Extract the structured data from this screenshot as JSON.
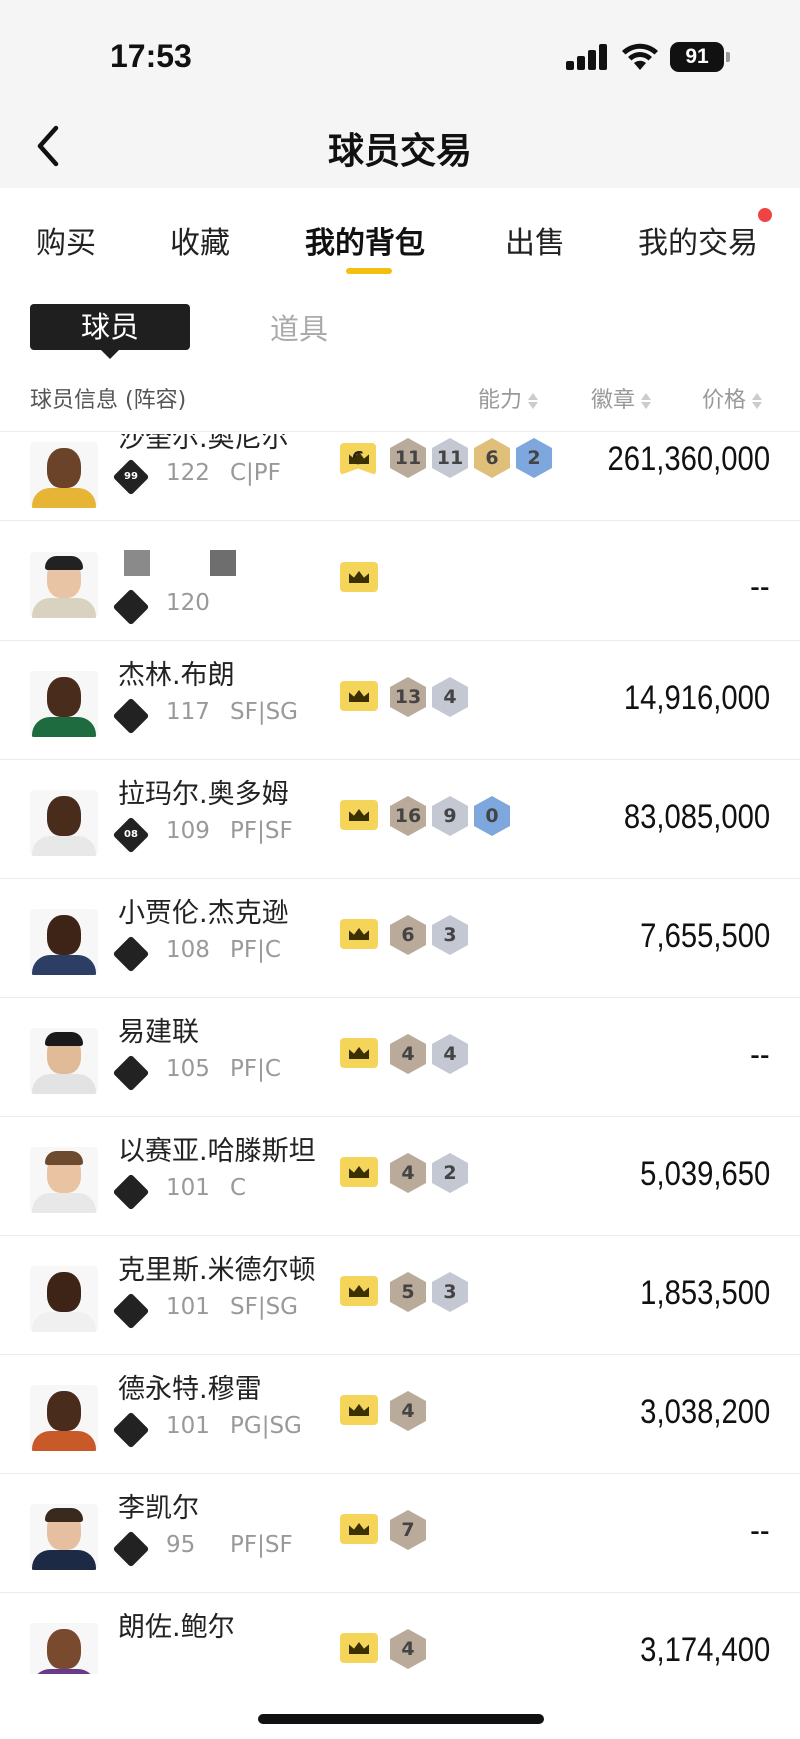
{
  "status_bar": {
    "time": "17:53",
    "battery": "91"
  },
  "nav": {
    "title": "球员交易"
  },
  "tabs": [
    {
      "label": "购买"
    },
    {
      "label": "收藏"
    },
    {
      "label": "我的背包"
    },
    {
      "label": "出售"
    },
    {
      "label": "我的交易"
    }
  ],
  "sub_tabs": [
    {
      "label": "球员"
    },
    {
      "label": "道具"
    }
  ],
  "header": {
    "info": "球员信息 (阵容)",
    "ability": "能力",
    "badge": "徽章",
    "price": "价格"
  },
  "players": [
    {
      "name": "沙奎尔.奥尼尔",
      "level": "99",
      "rating": "122",
      "pos": "C|PF",
      "price": "261,360,000",
      "badges": [
        "6",
        "11",
        "11",
        "6",
        "2"
      ]
    },
    {
      "name": "",
      "level": "",
      "rating": "120",
      "pos": "",
      "price": "--",
      "badges": []
    },
    {
      "name": "杰林.布朗",
      "level": "",
      "rating": "117",
      "pos": "SF|SG",
      "price": "14,916,000",
      "badges": [
        "13",
        "4"
      ]
    },
    {
      "name": "拉玛尔.奥多姆",
      "level": "08",
      "rating": "109",
      "pos": "PF|SF",
      "price": "83,085,000",
      "badges": [
        "16",
        "9",
        "0"
      ]
    },
    {
      "name": "小贾伦.杰克逊",
      "level": "",
      "rating": "108",
      "pos": "PF|C",
      "price": "7,655,500",
      "badges": [
        "6",
        "3"
      ]
    },
    {
      "name": "易建联",
      "level": "",
      "rating": "105",
      "pos": "PF|C",
      "price": "--",
      "badges": [
        "4",
        "4"
      ]
    },
    {
      "name": "以赛亚.哈滕斯坦",
      "level": "",
      "rating": "101",
      "pos": "C",
      "price": "5,039,650",
      "badges": [
        "4",
        "2"
      ]
    },
    {
      "name": "克里斯.米德尔顿",
      "level": "",
      "rating": "101",
      "pos": "SF|SG",
      "price": "1,853,500",
      "badges": [
        "5",
        "3"
      ]
    },
    {
      "name": "德永特.穆雷",
      "level": "",
      "rating": "101",
      "pos": "PG|SG",
      "price": "3,038,200",
      "badges": [
        "4"
      ]
    },
    {
      "name": "李凯尔",
      "level": "",
      "rating": "95",
      "pos": "PF|SF",
      "price": "--",
      "badges": [
        "7"
      ]
    },
    {
      "name": "朗佐.鲍尔",
      "level": "",
      "rating": "",
      "pos": "",
      "price": "3,174,400",
      "badges": [
        "4"
      ]
    }
  ],
  "colors": {
    "accent": "#f5bf12",
    "notification": "#ef4444",
    "gold_badge": "#e0bf7a",
    "silver_badge": "#c3c8d2",
    "bronze_badge": "#b9aa9a",
    "blue_badge": "#7ea7dd"
  }
}
